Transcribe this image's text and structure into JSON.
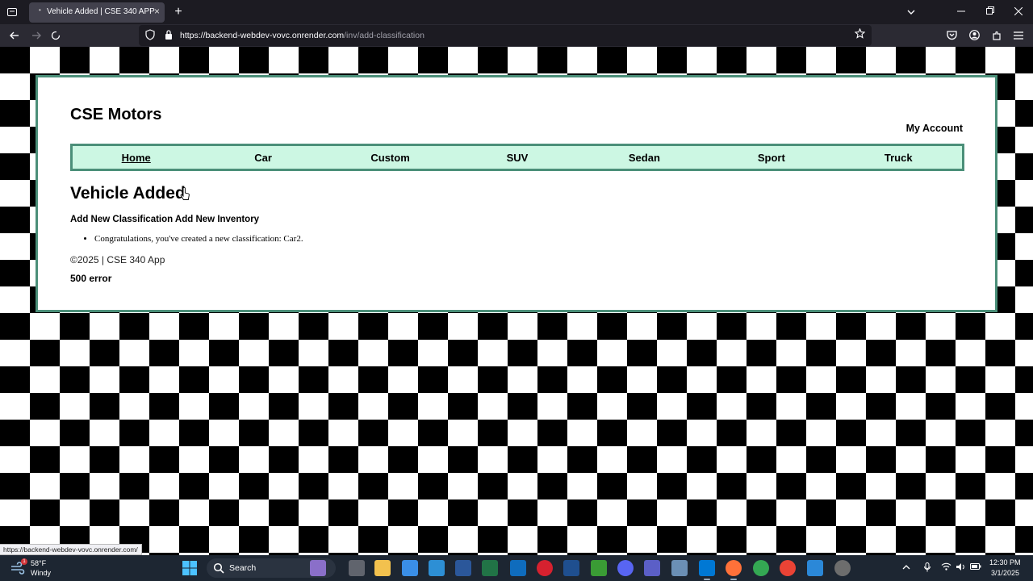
{
  "browser": {
    "tab": {
      "title": "Vehicle Added | CSE 340 APP",
      "close": "×",
      "loading_dot": "•"
    },
    "new_tab": "+",
    "url": {
      "host": "https://backend-webdev-vovc.onrender.com",
      "path": "/inv/add-classification"
    },
    "status_link": "https://backend-webdev-vovc.onrender.com/"
  },
  "site": {
    "name": "CSE Motors",
    "account_link": "My Account",
    "nav": [
      "Home",
      "Car",
      "Custom",
      "SUV",
      "Sedan",
      "Sport",
      "Truck"
    ],
    "nav_current": "Home"
  },
  "main": {
    "heading": "Vehicle Added",
    "links": "Add New Classification Add New Inventory",
    "messages": [
      "Congratulations, you've created a new classification: Car2."
    ],
    "copyright": "©2025 | CSE 340 App",
    "error": "500 error"
  },
  "taskbar": {
    "weather": {
      "temp": "58°F",
      "condition": "Windy",
      "badge": "1"
    },
    "search": "Search",
    "clock": {
      "time": "12:30 PM",
      "date": "3/1/2025"
    }
  },
  "colors": {
    "accent_border": "#4b8f79",
    "nav_background": "#ccf7e3",
    "page_background": "checkerboard black/white"
  }
}
